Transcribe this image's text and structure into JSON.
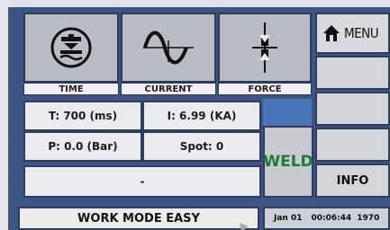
{
  "tiles": [
    {
      "label": "TIME",
      "icon": "press-icon"
    },
    {
      "label": "CURRENT",
      "icon": "sine-wave-icon"
    },
    {
      "label": "FORCE",
      "icon": "force-icon"
    }
  ],
  "readouts": {
    "time": "T: 700 (ms)",
    "current": "I: 6.99 (KA)",
    "pressure": "P: 0.0 (Bar)",
    "spot": "Spot: 0",
    "message": "-"
  },
  "weld_label": "WELD",
  "menu_label": "MENU",
  "info_label": "INFO",
  "mode_label": "WORK MODE EASY",
  "status": {
    "date": "Jan 01",
    "time": "00:06:44",
    "year": "1970"
  },
  "colors": {
    "accent_blue": "#4a76b8",
    "weld_green": "#1f7a33",
    "panel": "#3d5484"
  }
}
